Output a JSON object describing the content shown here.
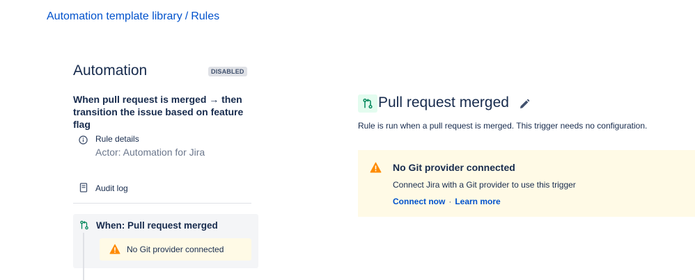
{
  "breadcrumb": {
    "parent": "Automation template library",
    "separator": "/",
    "current": "Rules"
  },
  "sidebar": {
    "title": "Automation",
    "status_badge": "DISABLED",
    "rule_name": "When pull request is merged → then transition the issue based on feature flag",
    "rule_details": {
      "label": "Rule details",
      "actor": "Actor: Automation for Jira",
      "icon": "info-icon"
    },
    "audit_log": {
      "label": "Audit log",
      "icon": "audit-log-icon"
    },
    "trigger": {
      "label": "When: Pull request merged",
      "icon": "pull-request-icon",
      "warning": "No Git provider connected",
      "warning_icon": "warning-icon"
    }
  },
  "main": {
    "title": "Pull request merged",
    "icon": "pull-request-icon",
    "edit_icon": "pencil-icon",
    "description": "Rule is run when a pull request is merged. This trigger needs no configuration.",
    "flag": {
      "title": "No Git provider connected",
      "body": "Connect Jira with a Git provider to use this trigger",
      "actions": [
        "Connect now",
        "Learn more"
      ],
      "separator": "·"
    }
  },
  "colors": {
    "link": "#0052CC",
    "text": "#172B4D",
    "subtle_text": "#6B778C",
    "warning_bg": "#FFFAE6",
    "warning_icon": "#FF8B00",
    "trigger_icon_bg": "#E3FCEF",
    "trigger_icon": "#00875A",
    "card_bg": "#F4F5F7"
  }
}
